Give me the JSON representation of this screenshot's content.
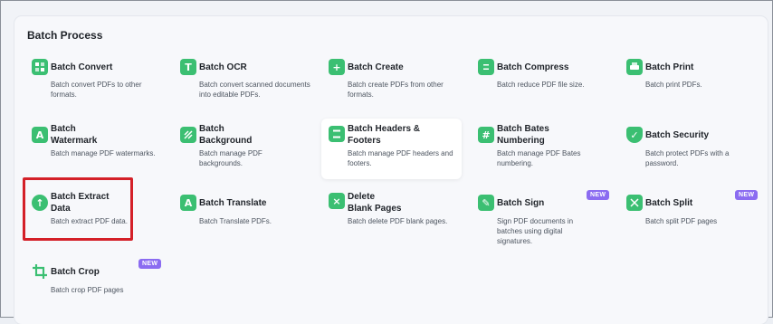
{
  "section_title": "Batch Process",
  "badge_text": "NEW",
  "tools": [
    {
      "name": "Batch Convert",
      "desc": "Batch convert PDFs to other formats.",
      "icon": "convert-icon"
    },
    {
      "name": "Batch OCR",
      "desc": "Batch convert scanned documents into editable PDFs.",
      "icon": "ocr-icon"
    },
    {
      "name": "Batch Create",
      "desc": "Batch create PDFs from other formats.",
      "icon": "create-icon"
    },
    {
      "name": "Batch Compress",
      "desc": "Batch reduce PDF file size.",
      "icon": "compress-icon"
    },
    {
      "name": "Batch Print",
      "desc": "Batch print PDFs.",
      "icon": "print-icon"
    },
    {
      "name": "Batch Watermark",
      "desc": "Batch manage PDF watermarks.",
      "icon": "watermark-icon"
    },
    {
      "name": "Batch Background",
      "desc": "Batch manage PDF backgrounds.",
      "icon": "background-icon"
    },
    {
      "name": "Batch Headers & Footers",
      "desc": "Batch manage PDF headers and footers.",
      "icon": "headers-footers-icon"
    },
    {
      "name": "Batch Bates Numbering",
      "desc": "Batch manage PDF Bates numbering.",
      "icon": "bates-icon"
    },
    {
      "name": "Batch Security",
      "desc": "Batch protect PDFs with a password.",
      "icon": "security-icon"
    },
    {
      "name": "Batch Extract Data",
      "desc": "Batch extract PDF data.",
      "icon": "extract-icon"
    },
    {
      "name": "Batch Translate",
      "desc": "Batch Translate PDFs.",
      "icon": "translate-icon"
    },
    {
      "name": "Delete Blank Pages",
      "desc": "Batch delete PDF blank pages.",
      "icon": "delete-blank-icon"
    },
    {
      "name": "Batch Sign",
      "desc": "Sign PDF documents in batches using digital signatures.",
      "icon": "sign-icon"
    },
    {
      "name": "Batch Split",
      "desc": "Batch split PDF pages",
      "icon": "split-icon"
    },
    {
      "name": "Batch Crop",
      "desc": "Batch crop PDF pages",
      "icon": "crop-icon"
    }
  ],
  "colors": {
    "accent": "#3bbf72",
    "badge": "#8b6cf1",
    "highlight": "#d42028"
  }
}
